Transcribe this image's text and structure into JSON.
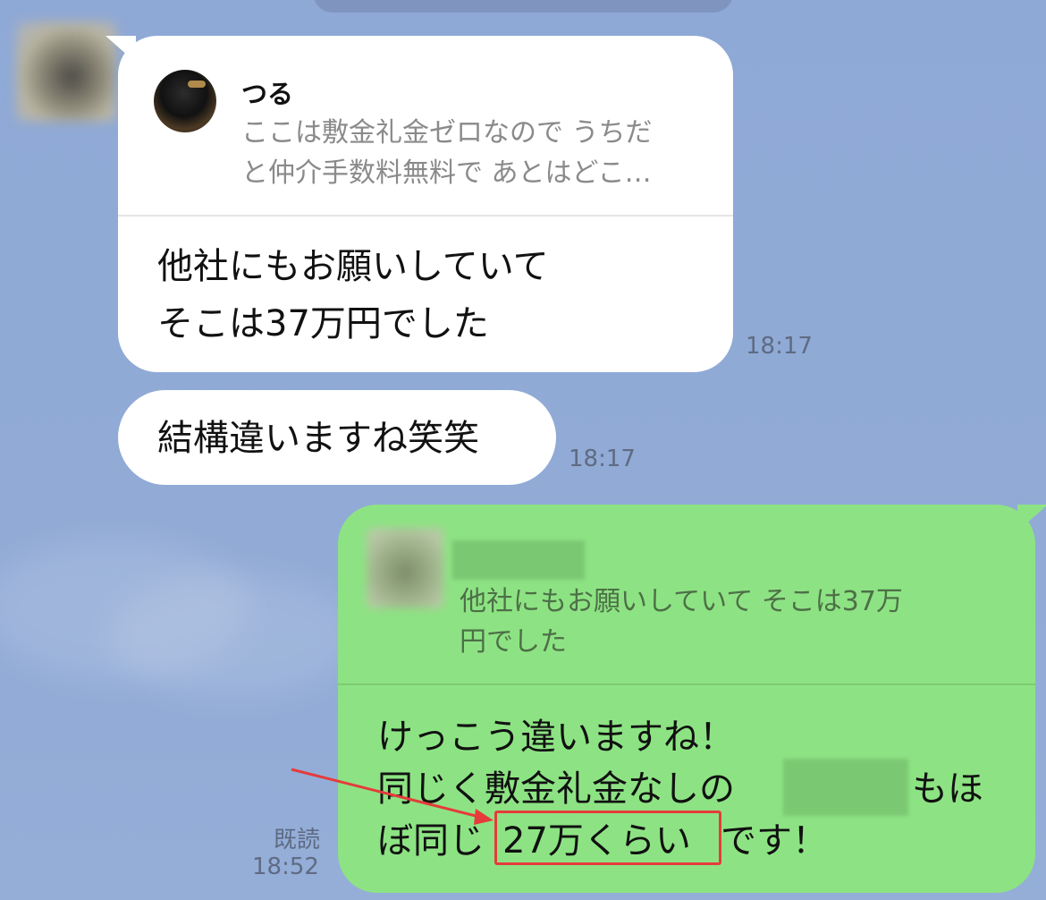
{
  "chat": {
    "messages": [
      {
        "reply": {
          "name": "つる",
          "preview": "ここは敷金礼金ゼロなので うちだ\nと仲介手数料無料で あとはどこ…"
        },
        "text": "他社にもお願いしていて\nそこは37万円でした",
        "time": "18:17"
      },
      {
        "text": "結構違いますね笑笑",
        "time": "18:17"
      },
      {
        "reply": {
          "preview": "他社にもお願いしていて そこは37万\n円でした"
        },
        "text_line1": "けっこう違いますね！",
        "text_line2_start": "同じく敷金礼金なしの",
        "text_line2_end": "もほ",
        "text_line3_start": "ぼ同じ",
        "highlight": "27万くらい",
        "text_line3_end": "です！",
        "read_label": "既読",
        "time": "18:52"
      }
    ]
  },
  "colors": {
    "background": "#91aad6",
    "incoming_bubble": "#ffffff",
    "outgoing_bubble": "#8de383",
    "annotation": "#e53b3b"
  }
}
